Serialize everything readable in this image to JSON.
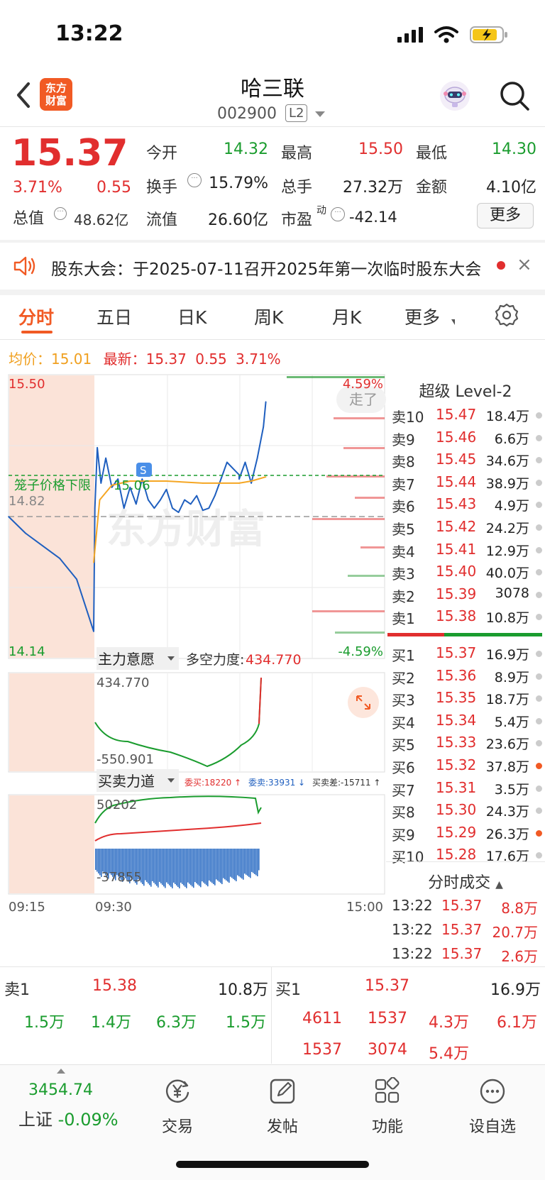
{
  "status_bar": {
    "time": "13:22"
  },
  "header": {
    "logo_text_1": "东方",
    "logo_text_2": "财富",
    "stock_name": "哈三联",
    "stock_code": "002900",
    "level": "L2"
  },
  "quote": {
    "price": "15.37",
    "change_pct": "3.71%",
    "change": "0.55",
    "total_value_label": "总值",
    "total_value": "48.62亿",
    "fields": {
      "open_label": "今开",
      "open": "14.32",
      "high_label": "最高",
      "high": "15.50",
      "low_label": "最低",
      "low": "14.30",
      "turnover_label": "换手",
      "turnover": "15.79%",
      "volume_label": "总手",
      "volume": "27.32万",
      "amount_label": "金额",
      "amount": "4.10亿",
      "float_label": "流值",
      "float": "26.60亿",
      "pe_label": "市盈",
      "pe_sup": "动",
      "pe": "-42.14"
    },
    "more_button": "更多"
  },
  "notice": {
    "text": "股东大会：于2025-07-11召开2025年第一次临时股东大会",
    "close": "×"
  },
  "tabs": [
    "分时",
    "五日",
    "日K",
    "周K",
    "月K",
    "更多"
  ],
  "chart_header": {
    "avg_label": "均价：",
    "avg_value": "15.01",
    "latest_label": "最新：",
    "latest_value": "15.37",
    "latest_change": "0.55",
    "latest_pct": "3.71%"
  },
  "chart_labels": {
    "y_top": "15.50",
    "y_mid": "14.82",
    "y_bottom": "14.14",
    "pct_top": "4.59%",
    "pct_bottom": "-4.59%",
    "cage_label": "笼子价格下限",
    "cage_value": "15.06",
    "badge": "S",
    "watermark": "东方财富",
    "moved_label": "走了",
    "ind1_name": "主力意愿",
    "ind1_title": "多空力度:",
    "ind1_value": "434.770",
    "ind1_top": "434.770",
    "ind1_bottom": "-550.901",
    "ind2_name": "买卖力道",
    "ind2_buy": "委买:18220 ↑",
    "ind2_sell": "委卖:33931 ↓",
    "ind2_diff": "买卖差:-15711 ↑",
    "ind2_top": "50202",
    "ind2_bottom": "-37855",
    "time_start": "09:15",
    "time_open": "09:30",
    "time_end": "15:00"
  },
  "chart_data": {
    "type": "line",
    "x_label": "time",
    "ylim": [
      14.14,
      15.5
    ],
    "prev_close": 14.82,
    "series": [
      {
        "name": "price",
        "color": "#1f5fbf",
        "x": [
          "09:15",
          "09:18",
          "09:21",
          "09:24",
          "09:27",
          "09:30",
          "09:31",
          "09:33",
          "09:36",
          "09:40",
          "09:45",
          "09:50",
          "09:55",
          "10:00",
          "10:05",
          "10:10",
          "10:15",
          "10:20",
          "10:25",
          "10:30",
          "10:35",
          "10:40",
          "10:45",
          "10:50",
          "10:55",
          "11:00",
          "11:05",
          "11:10",
          "11:15",
          "11:20",
          "11:25",
          "11:30",
          "13:00",
          "13:05",
          "13:10",
          "13:15",
          "13:20",
          "13:22"
        ],
        "values": [
          14.82,
          14.74,
          14.68,
          14.62,
          14.52,
          14.27,
          14.86,
          15.15,
          14.98,
          15.1,
          14.96,
          15.0,
          14.86,
          14.96,
          14.88,
          15.0,
          14.9,
          14.86,
          14.9,
          14.95,
          14.86,
          14.84,
          14.9,
          14.88,
          14.92,
          14.85,
          14.86,
          14.92,
          15.0,
          15.08,
          15.05,
          15.02,
          15.0,
          15.08,
          14.98,
          15.1,
          15.25,
          15.37
        ]
      },
      {
        "name": "avg",
        "color": "#f5a623",
        "x": [
          "09:30",
          "09:35",
          "09:45",
          "10:00",
          "10:30",
          "11:00",
          "11:30",
          "13:00",
          "13:10",
          "13:22"
        ],
        "values": [
          14.6,
          14.9,
          14.97,
          14.99,
          14.99,
          14.98,
          14.98,
          14.98,
          14.99,
          15.01
        ]
      }
    ]
  },
  "order_book": {
    "title": "超级 Level-2",
    "asks": [
      {
        "label": "卖10",
        "price": "15.47",
        "vol": "18.4万"
      },
      {
        "label": "卖9",
        "price": "15.46",
        "vol": "6.6万"
      },
      {
        "label": "卖8",
        "price": "15.45",
        "vol": "34.6万"
      },
      {
        "label": "卖7",
        "price": "15.44",
        "vol": "38.9万"
      },
      {
        "label": "卖6",
        "price": "15.43",
        "vol": "4.9万"
      },
      {
        "label": "卖5",
        "price": "15.42",
        "vol": "24.2万"
      },
      {
        "label": "卖4",
        "price": "15.41",
        "vol": "12.9万"
      },
      {
        "label": "卖3",
        "price": "15.40",
        "vol": "40.0万"
      },
      {
        "label": "卖2",
        "price": "15.39",
        "vol": "3078"
      },
      {
        "label": "卖1",
        "price": "15.38",
        "vol": "10.8万"
      }
    ],
    "bids": [
      {
        "label": "买1",
        "price": "15.37",
        "vol": "16.9万"
      },
      {
        "label": "买2",
        "price": "15.36",
        "vol": "8.9万"
      },
      {
        "label": "买3",
        "price": "15.35",
        "vol": "18.7万"
      },
      {
        "label": "买4",
        "price": "15.34",
        "vol": "5.4万"
      },
      {
        "label": "买5",
        "price": "15.33",
        "vol": "23.6万"
      },
      {
        "label": "买6",
        "price": "15.32",
        "vol": "37.8万"
      },
      {
        "label": "买7",
        "price": "15.31",
        "vol": "3.5万"
      },
      {
        "label": "买8",
        "price": "15.30",
        "vol": "24.3万"
      },
      {
        "label": "买9",
        "price": "15.29",
        "vol": "26.3万"
      },
      {
        "label": "买10",
        "price": "15.28",
        "vol": "17.6万"
      }
    ],
    "trades_title": "分时成交",
    "trades": [
      {
        "time": "13:22",
        "price": "15.37",
        "vol": "8.8万"
      },
      {
        "time": "13:22",
        "price": "15.37",
        "vol": "20.7万"
      },
      {
        "time": "13:22",
        "price": "15.37",
        "vol": "2.6万"
      }
    ]
  },
  "summary": {
    "sell_label": "卖1",
    "sell_price": "15.38",
    "sell_vol": "10.8万",
    "buy_label": "买1",
    "buy_price": "15.37",
    "buy_vol": "16.9万",
    "sell_queue": [
      "1.5万",
      "1.4万",
      "6.3万",
      "1.5万"
    ],
    "buy_queue_1": [
      "4611",
      "1537",
      "4.3万",
      "6.1万"
    ],
    "buy_queue_2": [
      "1537",
      "3074",
      "5.4万"
    ]
  },
  "bottom_nav": {
    "index_value": "3454.74",
    "index_name": "上证",
    "index_change": "-0.09%",
    "items": [
      "交易",
      "发帖",
      "功能",
      "设自选"
    ]
  }
}
